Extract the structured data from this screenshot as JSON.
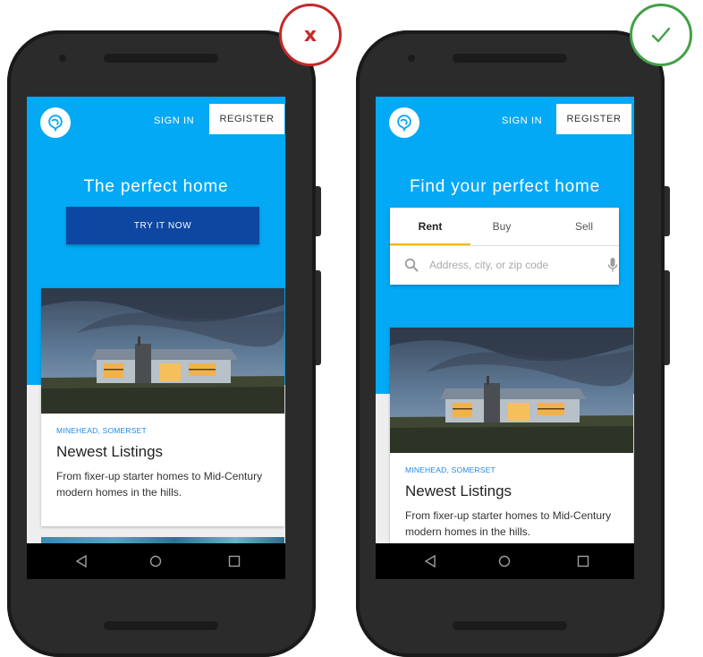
{
  "examples": [
    {
      "verdict": "x",
      "verdict_color": "#c62828",
      "header": {
        "sign_in": "SIGN IN",
        "register": "REGISTER"
      },
      "hero": {
        "title": "The perfect home",
        "cta": "TRY IT NOW"
      },
      "card": {
        "eyebrow": "MINEHEAD, SOMERSET",
        "title": "Newest Listings",
        "description": "From fixer-up starter homes to Mid-Century modern homes in the hills."
      }
    },
    {
      "verdict": "check",
      "verdict_color": "#43a047",
      "header": {
        "sign_in": "SIGN IN",
        "register": "REGISTER"
      },
      "hero": {
        "title": "Find your perfect home"
      },
      "search": {
        "tabs": [
          "Rent",
          "Buy",
          "Sell"
        ],
        "selected_tab": "Rent",
        "placeholder": "Address, city, or zip code"
      },
      "card": {
        "eyebrow": "MINEHEAD, SOMERSET",
        "title": "Newest Listings",
        "description": "From fixer-up starter homes to Mid-Century modern homes in the hills."
      }
    }
  ],
  "colors": {
    "primary": "#03a9f4",
    "cta": "#0d47a1",
    "tab_indicator": "#f5b400",
    "eyebrow": "#1e88e5"
  },
  "icons": [
    "logo-icon",
    "search-icon",
    "mic-icon",
    "back-icon",
    "home-icon",
    "recents-icon",
    "x-icon",
    "check-icon"
  ]
}
